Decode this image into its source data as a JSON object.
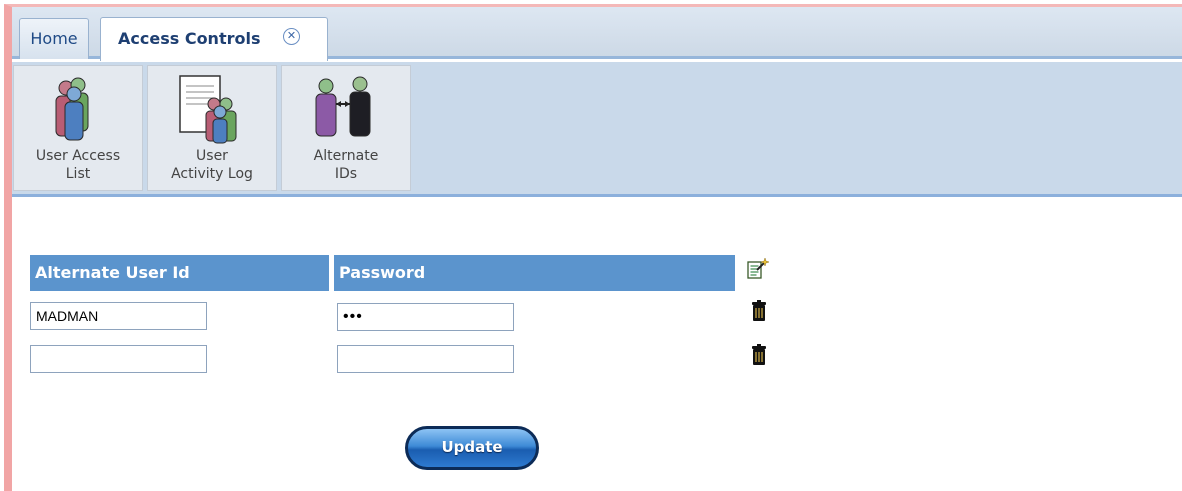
{
  "tabs": [
    {
      "label": "Home"
    },
    {
      "label": "Access Controls",
      "close_glyph": "✕"
    }
  ],
  "toolbar": [
    {
      "label": "User Access\nList",
      "icon": "users-group-icon"
    },
    {
      "label": "User\nActivity Log",
      "icon": "activity-log-icon"
    },
    {
      "label": "Alternate\nIDs",
      "icon": "alternate-ids-icon"
    }
  ],
  "table": {
    "headers": [
      "Alternate User Id",
      "Password"
    ],
    "rows": [
      {
        "user_id": "MADMAN",
        "password": "•••"
      },
      {
        "user_id": "",
        "password": ""
      }
    ]
  },
  "actions": {
    "update_label": "Update"
  },
  "colors": {
    "header_bg": "#5b94cd",
    "toolbar_bg": "#c9d9ea",
    "button_bg": "#2e7ad0"
  }
}
